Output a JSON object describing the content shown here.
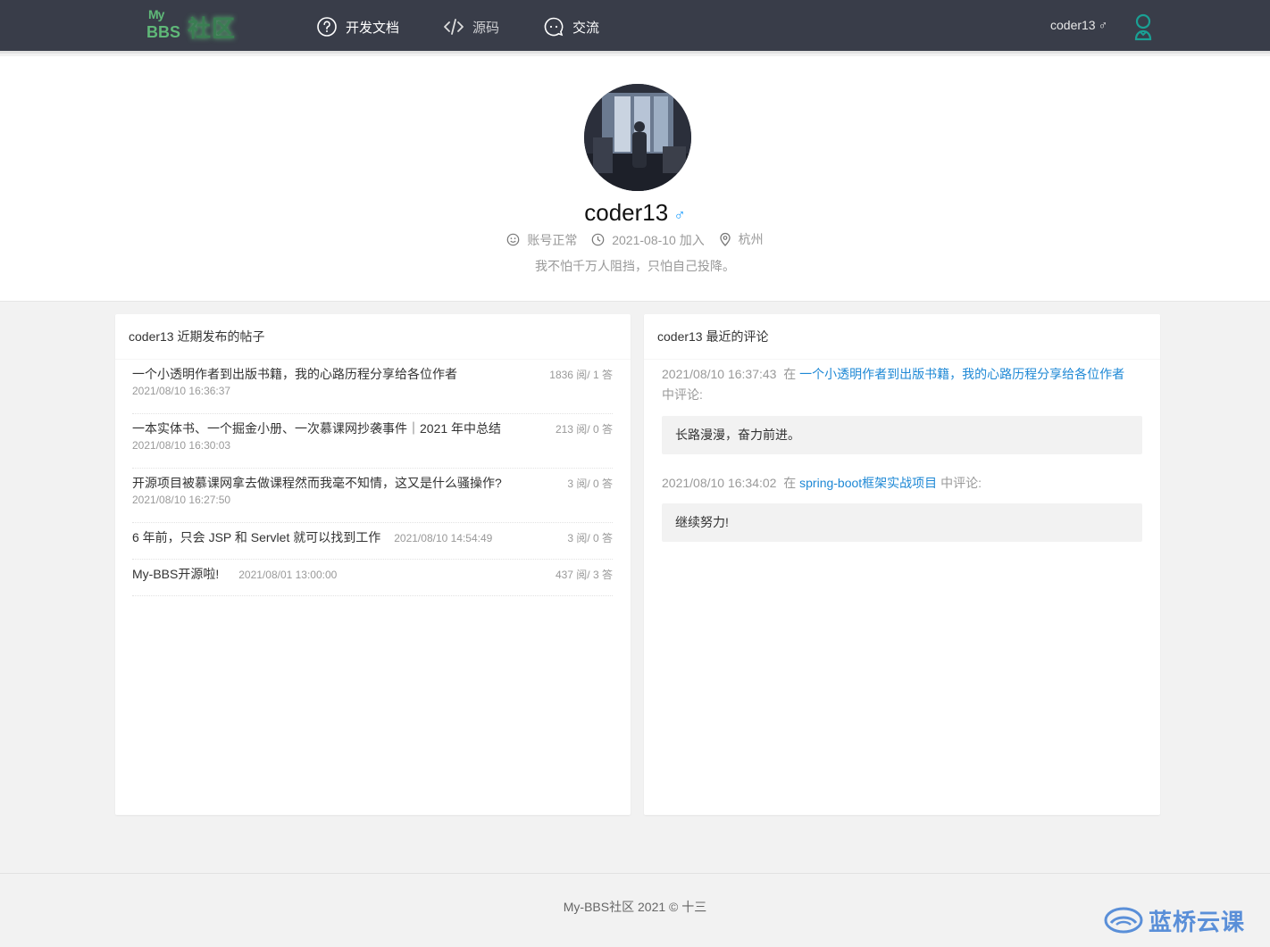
{
  "brand": {
    "my": "My",
    "bbs": "BBS",
    "cn": "社区"
  },
  "nav": [
    {
      "label": "开发文档",
      "icon": "help-circle-icon"
    },
    {
      "label": "源码",
      "icon": "code-icon"
    },
    {
      "label": "交流",
      "icon": "chat-icon"
    }
  ],
  "current_user": {
    "name": "coder13",
    "gender_symbol": "♂"
  },
  "profile": {
    "name": "coder13",
    "gender_symbol": "♂",
    "status": "账号正常",
    "joined": "2021-08-10 加入",
    "city": "杭州",
    "signature": "我不怕千万人阻挡，只怕自己投降。"
  },
  "posts_card": {
    "title": "coder13 近期发布的帖子",
    "posts": [
      {
        "title": "一个小透明作者到出版书籍，我的心路历程分享给各位作者",
        "date": "2021/08/10 16:36:37",
        "stats": "1836 阅/ 1 答"
      },
      {
        "title": "一本实体书、一个掘金小册、一次慕课网抄袭事件｜2021 年中总结",
        "date": "2021/08/10 16:30:03",
        "stats": "213 阅/ 0 答"
      },
      {
        "title": "开源项目被慕课网拿去做课程然而我毫不知情，这又是什么骚操作?",
        "date": "2021/08/10 16:27:50",
        "stats": "3 阅/ 0 答"
      },
      {
        "title": "6 年前，只会 JSP 和 Servlet 就可以找到工作",
        "date": "2021/08/10 14:54:49",
        "stats": "3 阅/ 0 答"
      },
      {
        "title": "My-BBS开源啦!",
        "date": "2021/08/01 13:00:00",
        "stats": "437 阅/ 3 答"
      }
    ]
  },
  "comments_card": {
    "title": "coder13 最近的评论",
    "comments": [
      {
        "time": "2021/08/10 16:37:43",
        "prefix": "在",
        "topic": "一个小透明作者到出版书籍，我的心路历程分享给各位作者",
        "suffix": "中评论:",
        "content": "长路漫漫，奋力前进。"
      },
      {
        "time": "2021/08/10 16:34:02",
        "prefix": "在",
        "topic": "spring-boot框架实战项目",
        "suffix": "中评论:",
        "content": "继续努力!"
      }
    ]
  },
  "footer": {
    "text": "My-BBS社区 2021 ©  十三"
  },
  "watermark": {
    "text": "蓝桥云课"
  }
}
